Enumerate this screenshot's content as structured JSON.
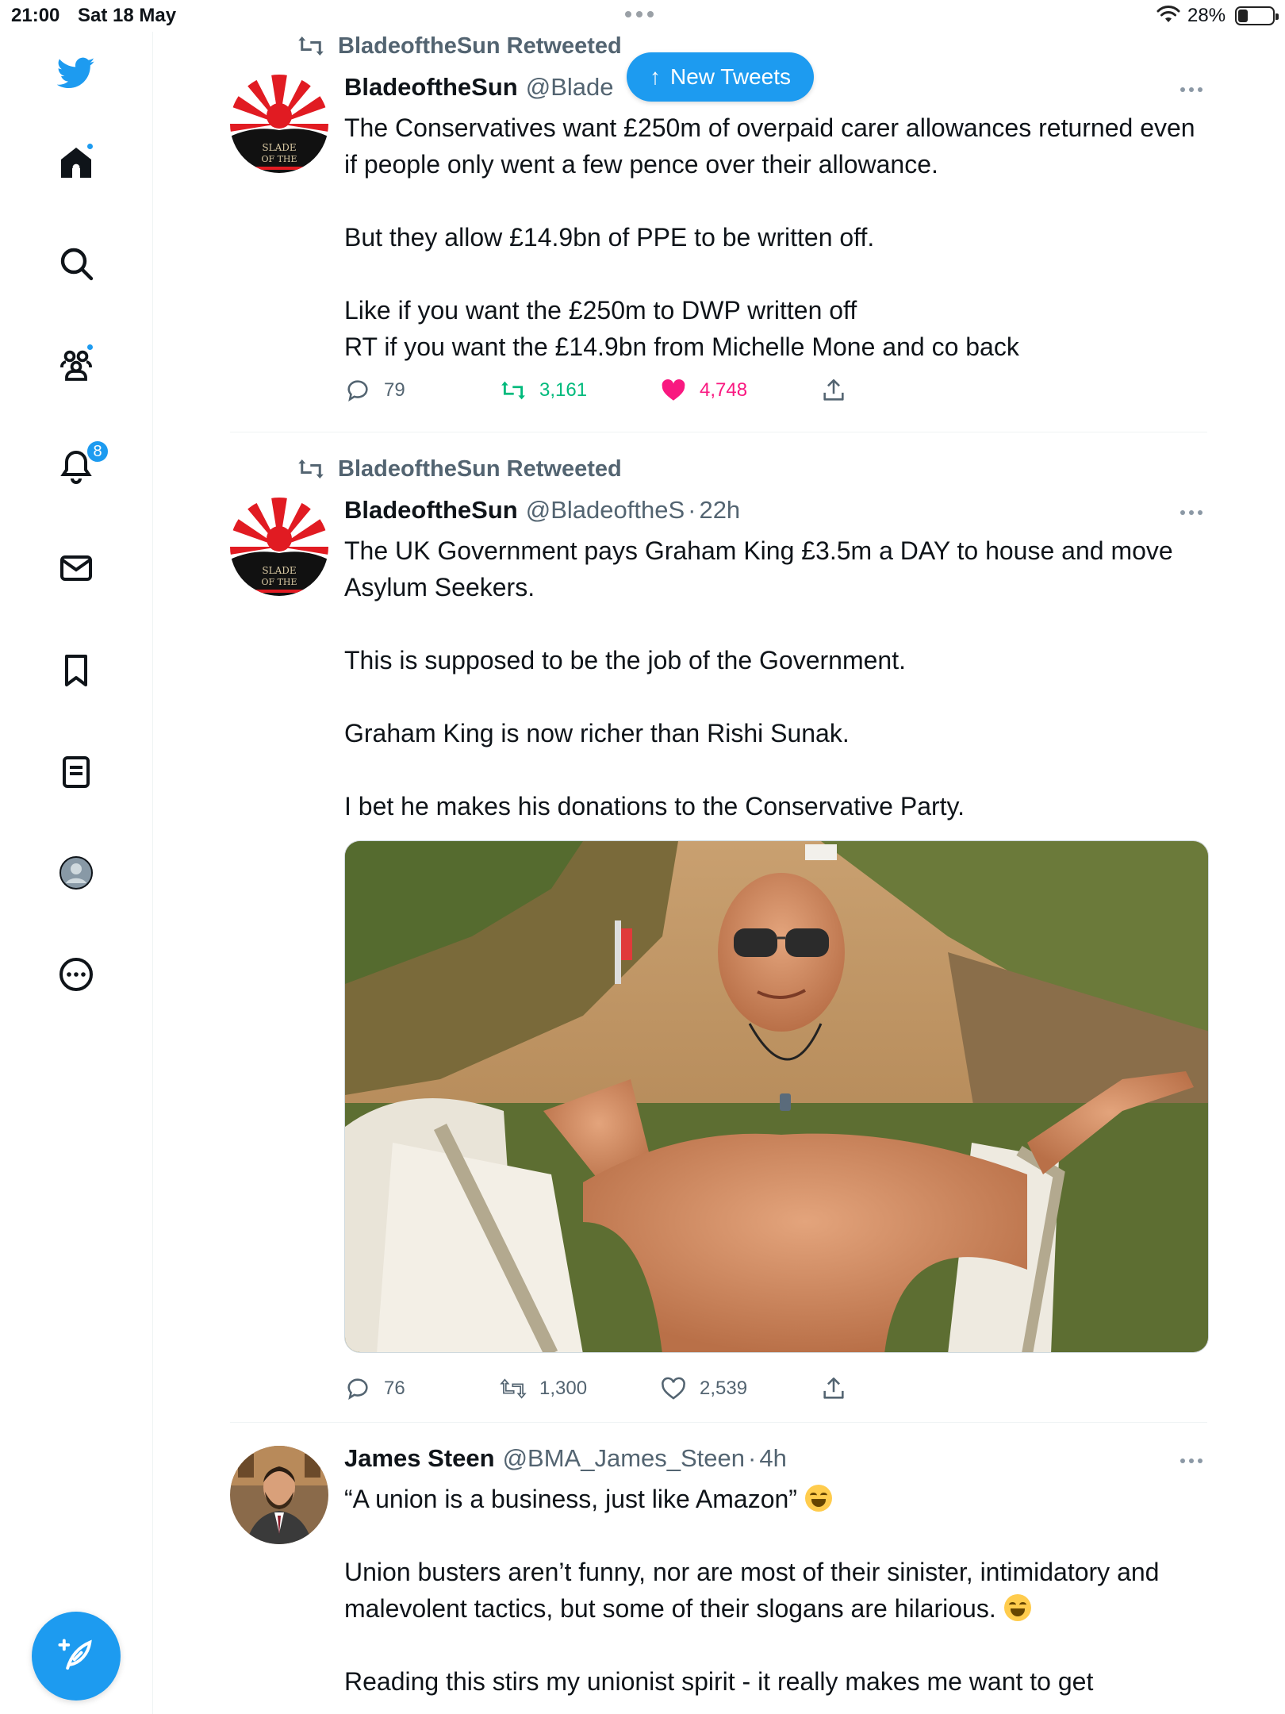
{
  "status_bar": {
    "time": "21:00",
    "date": "Sat 18 May",
    "battery_percent": "28%",
    "battery_level": 0.28
  },
  "sidebar": {
    "items": [
      {
        "icon": "twitter-logo-icon"
      },
      {
        "icon": "home-icon",
        "has_dot": true
      },
      {
        "icon": "search-icon"
      },
      {
        "icon": "communities-icon",
        "has_dot": true
      },
      {
        "icon": "notifications-icon",
        "badge": "8"
      },
      {
        "icon": "messages-icon"
      },
      {
        "icon": "bookmarks-icon"
      },
      {
        "icon": "lists-icon"
      },
      {
        "icon": "profile-icon"
      },
      {
        "icon": "more-icon"
      }
    ],
    "compose_icon": "compose-tweet-icon"
  },
  "new_tweets": {
    "label": "New Tweets"
  },
  "tweets": [
    {
      "retweeted_by": "BladeoftheSun Retweeted",
      "name": "BladeoftheSun",
      "handle": "@Blade",
      "text": [
        "The Conservatives want £250m of overpaid carer allowances returned even if people only went a few pence over their allowance.",
        "But they allow £14.9bn of PPE to be written off.",
        "Like if you want the £250m to DWP written off",
        "RT if you want the £14.9bn from Michelle Mone and co back"
      ],
      "replies": "79",
      "retweets": "3,161",
      "likes": "4,748",
      "retweeted": true,
      "liked": true
    },
    {
      "retweeted_by": "BladeoftheSun Retweeted",
      "name": "BladeoftheSun",
      "handle": "@BladeoftheS",
      "time": "22h",
      "text": [
        "The UK Government pays Graham King £3.5m a DAY to house and move Asylum Seekers.",
        "This is supposed to be the job of the Government.",
        "Graham King is now richer than Rishi Sunak.",
        "I bet he makes his donations to the Conservative Party."
      ],
      "replies": "76",
      "retweets": "1,300",
      "likes": "2,539",
      "retweeted": false,
      "liked": false
    },
    {
      "name": "James Steen",
      "handle": "@BMA_James_Steen",
      "time": "4h",
      "text": [
        "“A union is a business, just like Amazon”",
        "Union busters aren’t funny, nor are most of their sinister, intimidatory and malevolent tactics, but some of their slogans are hilarious.",
        "Reading this stirs my unionist spirit - it really makes me want to get"
      ]
    }
  ],
  "colors": {
    "accent": "#1d9bf0",
    "retweet_green": "#00ba7c",
    "like_pink": "#f91880",
    "secondary_text": "#536471"
  }
}
